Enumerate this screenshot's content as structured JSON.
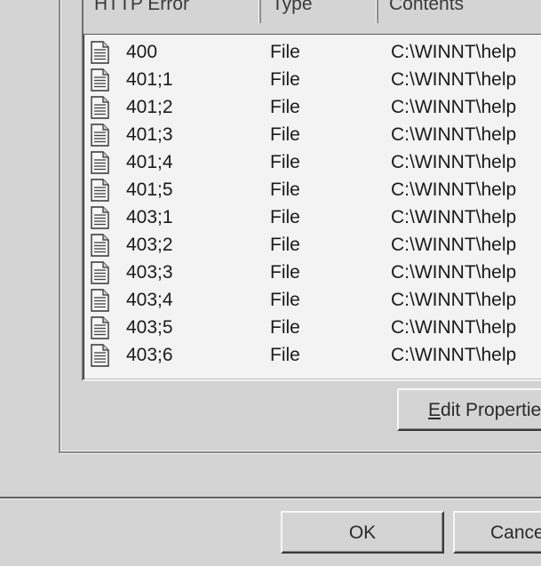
{
  "list": {
    "columns": [
      "HTTP Error",
      "Type",
      "Contents"
    ],
    "rows": [
      {
        "error": "400",
        "type": "File",
        "contents": "C:\\WINNT\\help"
      },
      {
        "error": "401;1",
        "type": "File",
        "contents": "C:\\WINNT\\help"
      },
      {
        "error": "401;2",
        "type": "File",
        "contents": "C:\\WINNT\\help"
      },
      {
        "error": "401;3",
        "type": "File",
        "contents": "C:\\WINNT\\help"
      },
      {
        "error": "401;4",
        "type": "File",
        "contents": "C:\\WINNT\\help"
      },
      {
        "error": "401;5",
        "type": "File",
        "contents": "C:\\WINNT\\help"
      },
      {
        "error": "403;1",
        "type": "File",
        "contents": "C:\\WINNT\\help"
      },
      {
        "error": "403;2",
        "type": "File",
        "contents": "C:\\WINNT\\help"
      },
      {
        "error": "403;3",
        "type": "File",
        "contents": "C:\\WINNT\\help"
      },
      {
        "error": "403;4",
        "type": "File",
        "contents": "C:\\WINNT\\help"
      },
      {
        "error": "403;5",
        "type": "File",
        "contents": "C:\\WINNT\\help"
      },
      {
        "error": "403;6",
        "type": "File",
        "contents": "C:\\WINNT\\help"
      }
    ],
    "row_icon": "document-icon"
  },
  "buttons": {
    "edit_properties": {
      "mnemonic": "E",
      "rest": "dit Properties"
    },
    "ok": "OK",
    "cancel": "Cancel"
  }
}
